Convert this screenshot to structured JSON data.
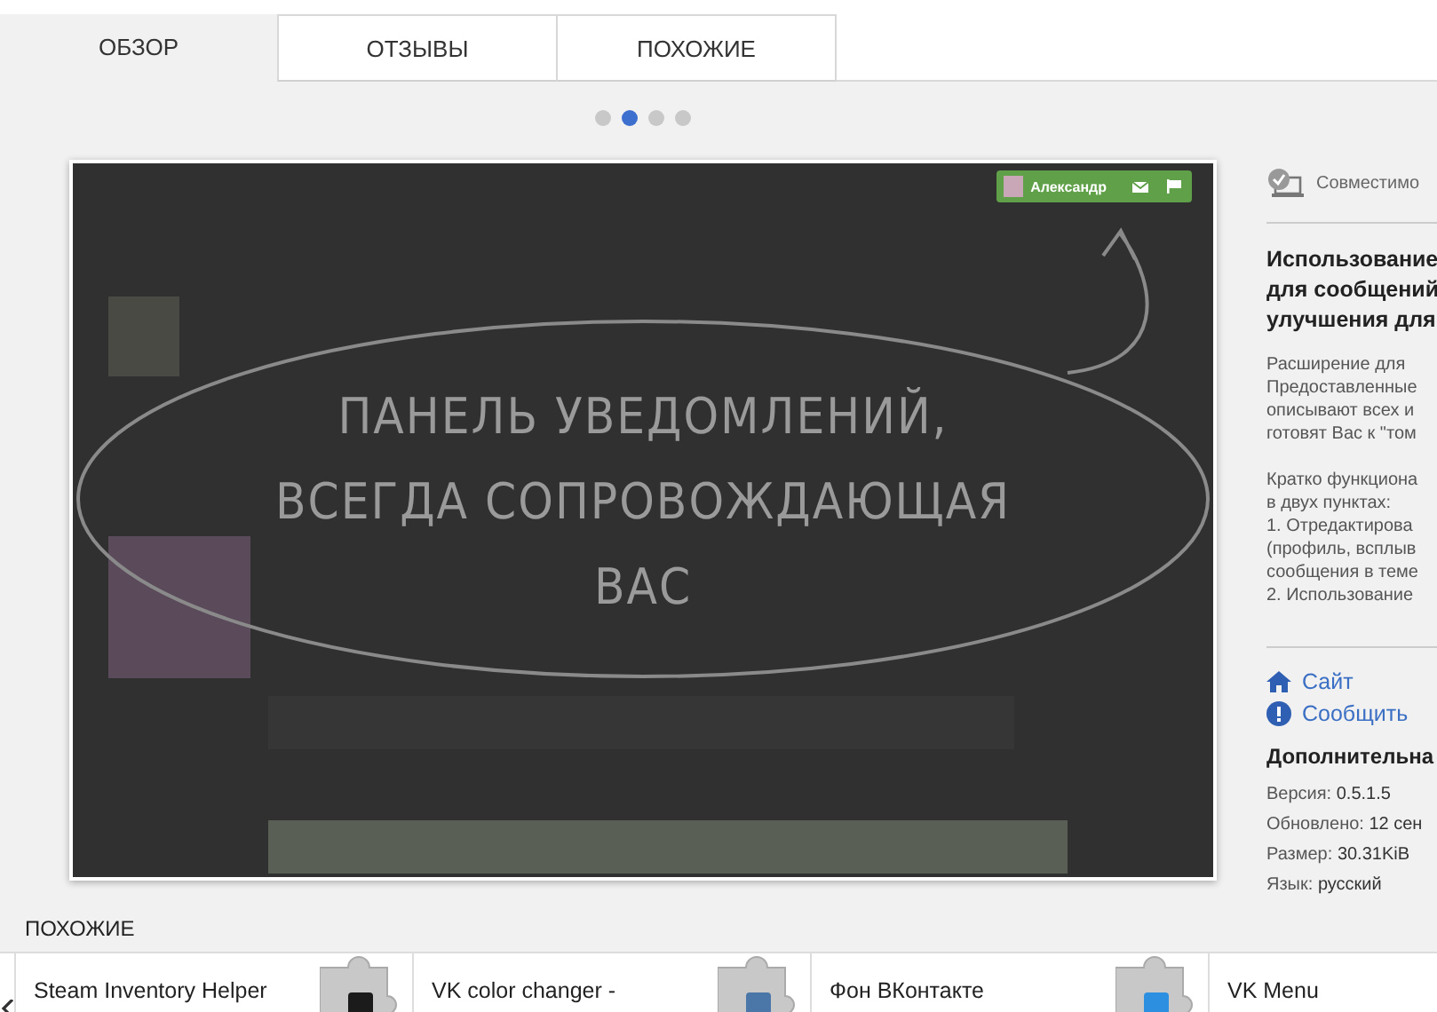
{
  "tabs": [
    {
      "label": "ОБЗОР",
      "selected": true
    },
    {
      "label": "ОТЗЫВЫ",
      "selected": false
    },
    {
      "label": "ПОХОЖИЕ",
      "selected": false
    }
  ],
  "carousel": {
    "dots": [
      {
        "selected": false
      },
      {
        "selected": true
      },
      {
        "selected": false
      },
      {
        "selected": false
      }
    ],
    "slide": {
      "user_name": "Александр",
      "caption_lines": [
        "ПАНЕЛЬ УВЕДОМЛЕНИЙ,",
        "ВСЕГДА СОПРОВОЖДАЮЩАЯ",
        "ВАС"
      ]
    }
  },
  "sidebar": {
    "compatibility": "Совместимо",
    "title_lines": [
      "Использование",
      "для сообщений",
      "улучшения для"
    ],
    "description_paragraphs": [
      [
        "Расширение для",
        "Предоставленные",
        "описывают всех и",
        "готовят Вас к \"том"
      ],
      [
        "Кратко функциона",
        "в двух пунктах:",
        "1. Отредактирова",
        "(профиль, всплыв",
        "сообщения в теме",
        "2. Использование"
      ]
    ],
    "links": [
      {
        "kind": "home",
        "label": "Сайт"
      },
      {
        "kind": "report",
        "label": "Сообщить"
      }
    ],
    "details_title": "Дополнительна",
    "details": [
      {
        "label": "Версия:",
        "value": "0.5.1.5"
      },
      {
        "label": "Обновлено:",
        "value": "12 сен"
      },
      {
        "label": "Размер:",
        "value": "30.31KiB"
      },
      {
        "label": "Язык:",
        "value": "русский"
      }
    ]
  },
  "similar": {
    "heading": "ПОХОЖИЕ",
    "items": [
      {
        "name": "Steam Inventory Helper",
        "color": "#1b1b1b"
      },
      {
        "name": "VK color changer -",
        "color": "#4a76a8"
      },
      {
        "name": "Фон ВКонтакте",
        "color": "#2d8fe0"
      },
      {
        "name": "VK Menu"
      }
    ]
  }
}
